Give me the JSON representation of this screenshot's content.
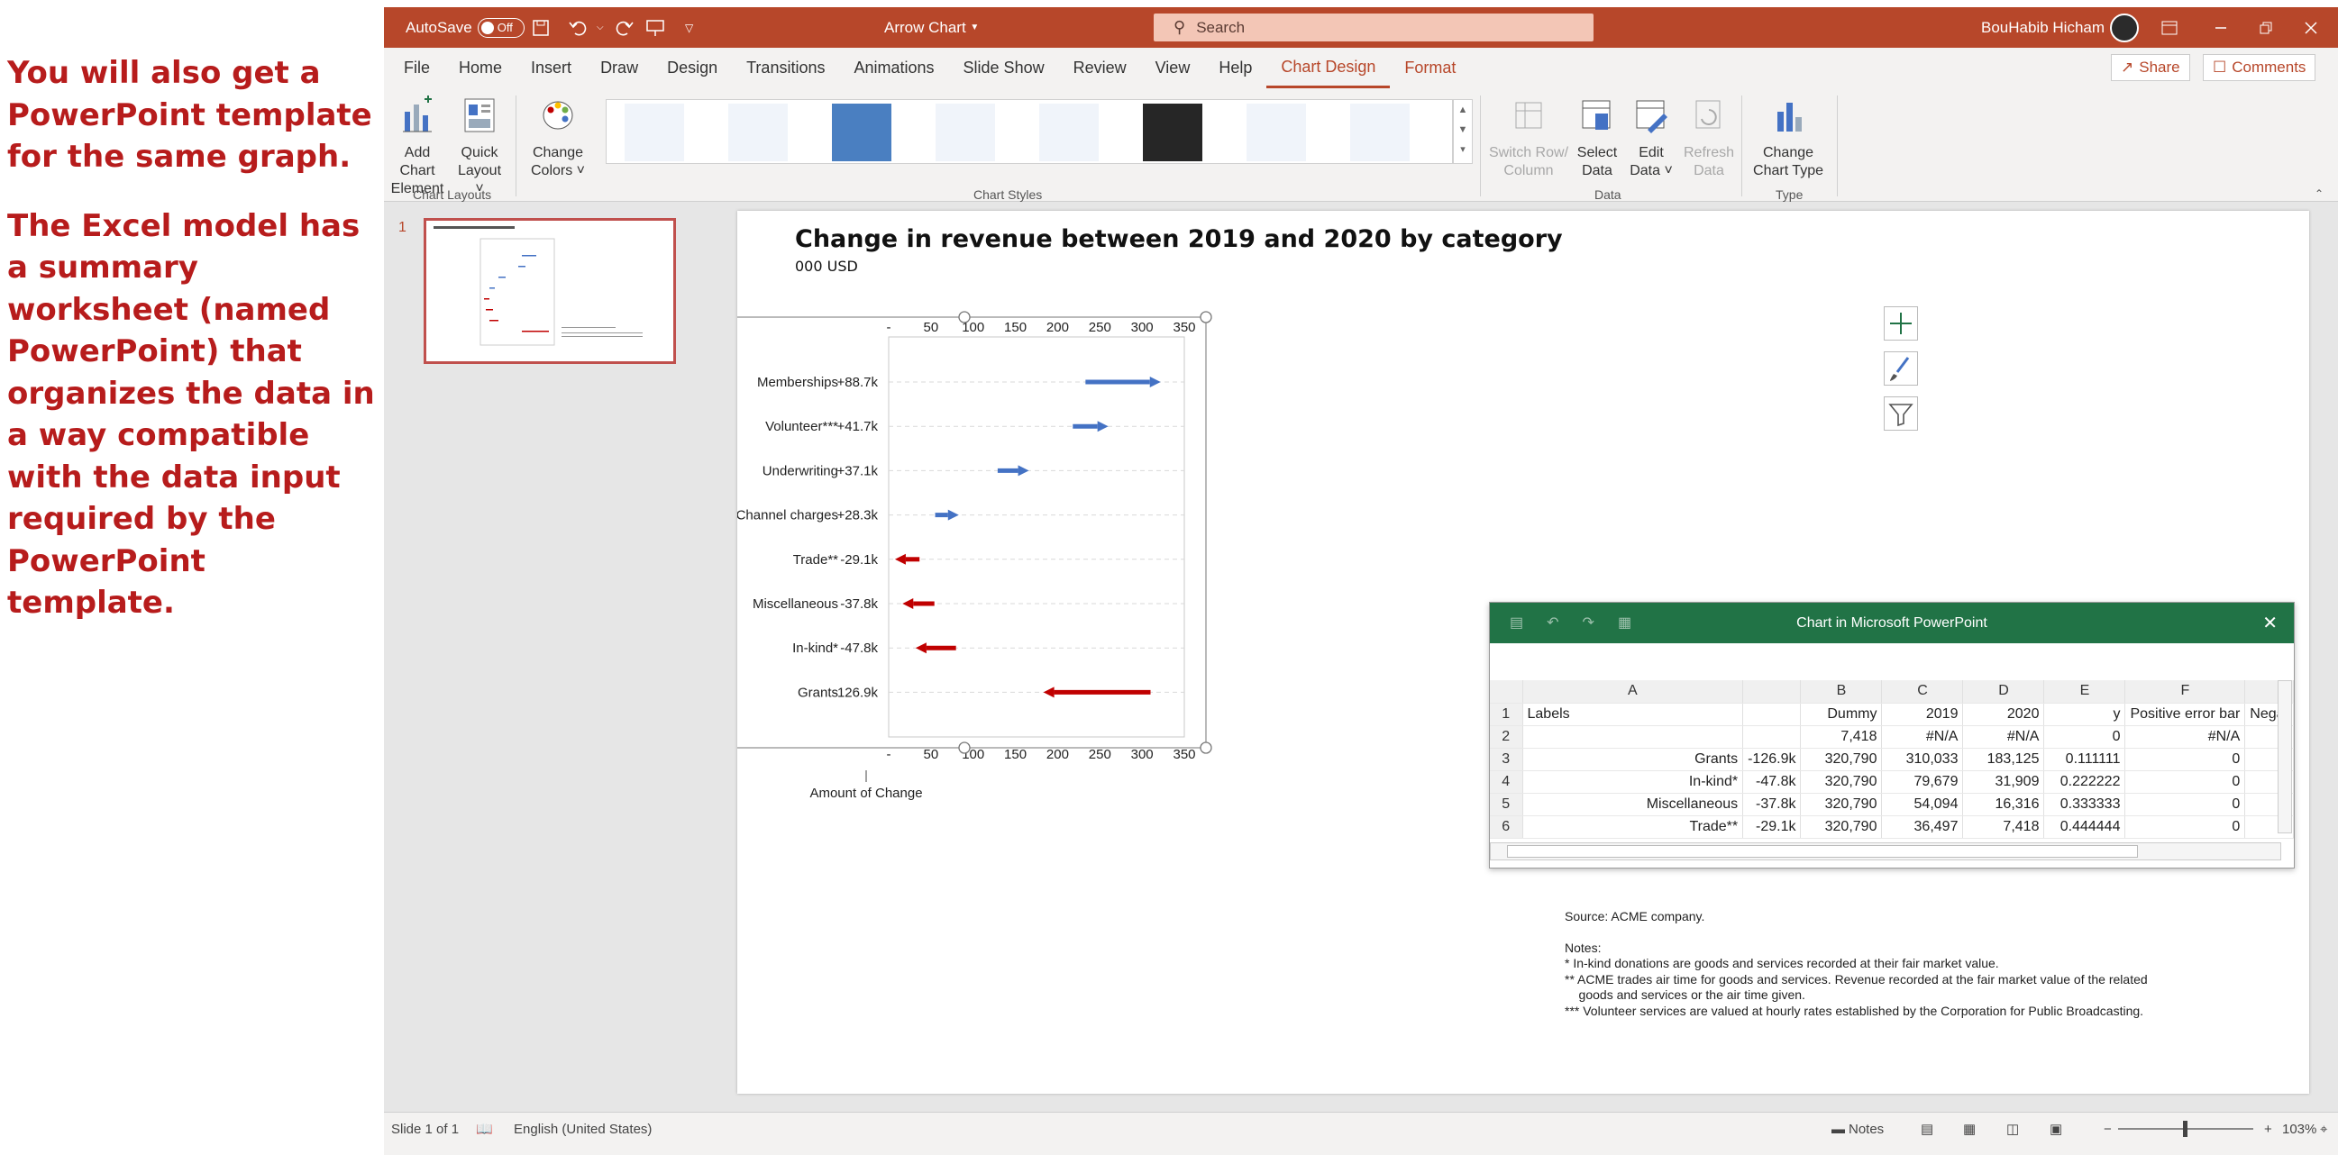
{
  "caption": {
    "para1": "You will also get a PowerPoint template for the same graph.",
    "para2": "The Excel model has a summary worksheet (named PowerPoint) that organizes the data in a way compatible with the data input required by the PowerPoint template."
  },
  "titlebar": {
    "autosave": "AutoSave",
    "autosave_state": "Off",
    "doc_title": "Arrow Chart",
    "search_placeholder": "Search",
    "user": "BouHabib Hicham"
  },
  "tabs": [
    "File",
    "Home",
    "Insert",
    "Draw",
    "Design",
    "Transitions",
    "Animations",
    "Slide Show",
    "Review",
    "View",
    "Help",
    "Chart Design",
    "Format"
  ],
  "active_tab": "Chart Design",
  "share": "Share",
  "comments": "Comments",
  "ribbon": {
    "add_chart_element": [
      "Add Chart",
      "Element ˅"
    ],
    "quick_layout": [
      "Quick",
      "Layout ˅"
    ],
    "change_colors": [
      "Change",
      "Colors ˅"
    ],
    "switch_row_col": [
      "Switch Row/",
      "Column"
    ],
    "select_data": [
      "Select",
      "Data"
    ],
    "edit_data": [
      "Edit",
      "Data ˅"
    ],
    "refresh_data": [
      "Refresh",
      "Data"
    ],
    "change_chart_type": [
      "Change",
      "Chart Type"
    ],
    "groups": {
      "chart_layouts": "Chart Layouts",
      "chart_styles": "Chart Styles",
      "data": "Data",
      "type": "Type"
    }
  },
  "slide_number": "1",
  "slide": {
    "title": "Change in revenue between 2019 and 2020 by category",
    "subtitle": "000 USD",
    "notes": [
      "Source: ACME company.",
      "",
      "Notes:",
      "* In-kind donations are goods and services recorded at their fair market value.",
      "** ACME trades air time for goods and services. Revenue recorded at the fair market value of the related",
      "    goods and services or the air time given.",
      "*** Volunteer services are valued at hourly rates established by the Corporation for Public Broadcasting."
    ]
  },
  "chart_data": {
    "type": "arrow",
    "title": "Change in revenue between 2019 and 2020 by category",
    "subtitle": "000 USD",
    "xlabel": "Amount of Change",
    "xlim": [
      0,
      350
    ],
    "xticks": [
      "-",
      "50",
      "100",
      "150",
      "200",
      "250",
      "300",
      "350"
    ],
    "grid": false,
    "categories": [
      "Memberships",
      "Volunteer***",
      "Underwriting",
      "Channel charges",
      "Trade**",
      "Miscellaneous",
      "In-kind*",
      "Grants"
    ],
    "changes": [
      "+88.7k",
      "+41.7k",
      "+37.1k",
      "+28.3k",
      "-29.1k",
      "-37.8k",
      "-47.8k",
      "-126.9k"
    ],
    "start": [
      233,
      218,
      129,
      55,
      36.5,
      54.1,
      79.7,
      310.0
    ],
    "end": [
      322,
      260,
      166,
      83,
      7.4,
      16.3,
      31.9,
      183.1
    ],
    "colors": {
      "positive": "#4472c4",
      "negative": "#c00000"
    }
  },
  "excel": {
    "title": "Chart in Microsoft PowerPoint",
    "columns": [
      "A",
      "",
      "B",
      "C",
      "D",
      "E",
      "F",
      ""
    ],
    "rows": [
      [
        "1",
        "Labels",
        "",
        "Dummy",
        "2019",
        "2020",
        "y",
        "Positive error bar",
        "Negat"
      ],
      [
        "2",
        "",
        "",
        "7,418",
        "#N/A",
        "#N/A",
        "0",
        "#N/A",
        ""
      ],
      [
        "3",
        "Grants",
        "-126.9k",
        "320,790",
        "310,033",
        "183,125",
        "0.111111",
        "0",
        ""
      ],
      [
        "4",
        "In-kind*",
        "-47.8k",
        "320,790",
        "79,679",
        "31,909",
        "0.222222",
        "0",
        ""
      ],
      [
        "5",
        "Miscellaneous",
        "-37.8k",
        "320,790",
        "54,094",
        "16,316",
        "0.333333",
        "0",
        ""
      ],
      [
        "6",
        "Trade**",
        "-29.1k",
        "320,790",
        "36,497",
        "7,418",
        "0.444444",
        "0",
        ""
      ]
    ]
  },
  "status": {
    "slide_of": "Slide 1 of 1",
    "language": "English (United States)",
    "notes": "Notes",
    "zoom": "103%"
  }
}
